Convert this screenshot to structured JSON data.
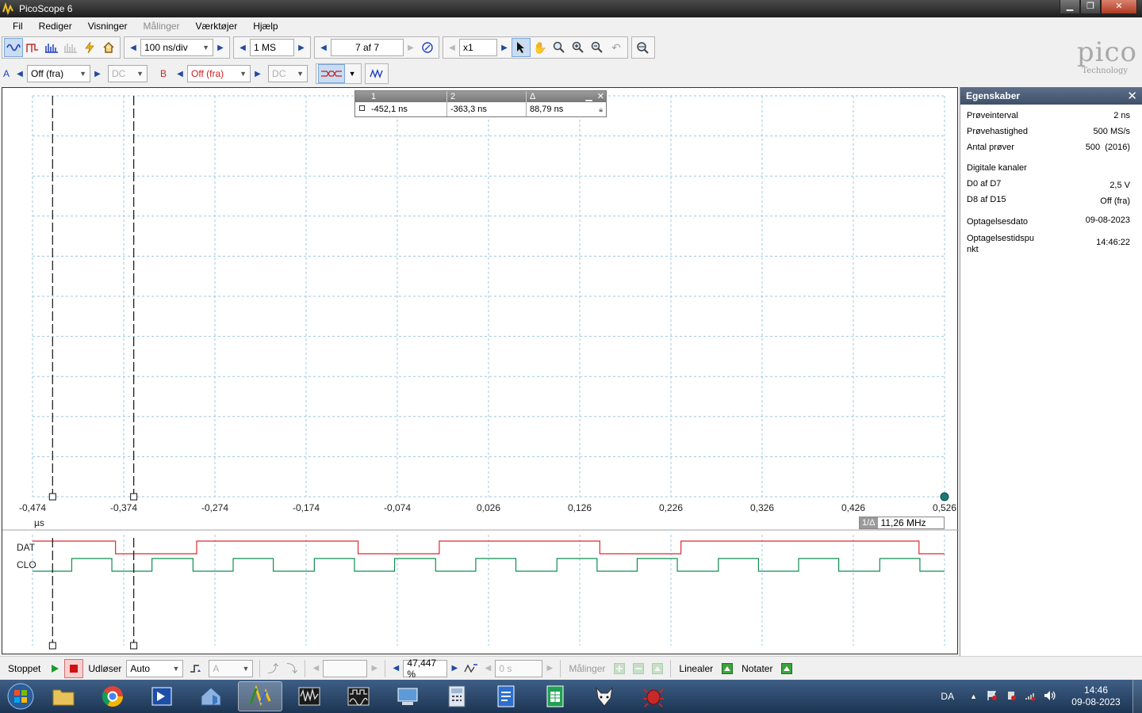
{
  "window": {
    "title": "PicoScope 6"
  },
  "menu": [
    "Fil",
    "Rediger",
    "Visninger",
    "Målinger",
    "Værktøjer",
    "Hjælp"
  ],
  "menu_disabled": [
    false,
    false,
    false,
    true,
    false,
    false
  ],
  "toolbar": {
    "timebase": "100 ns/div",
    "samples": "1 MS",
    "buffer": "7 af 7",
    "zoom": "x1"
  },
  "channels": {
    "a": {
      "label": "A",
      "range": "Off (fra)",
      "coupling": "DC",
      "color": "#1f3fbf"
    },
    "b": {
      "label": "B",
      "range": "Off (fra)",
      "coupling": "DC",
      "color": "#d02020"
    }
  },
  "logo": {
    "text": "pico",
    "sub": "Technology"
  },
  "scope": {
    "x_ticks": [
      "-0,474",
      "-0,374",
      "-0,274",
      "-0,174",
      "-0,074",
      "0,026",
      "0,126",
      "0,226",
      "0,326",
      "0,426",
      "0,526"
    ],
    "x_unit": "µs",
    "digital_channels": [
      "DAT",
      "CLO"
    ],
    "ruler_table": {
      "headers": [
        "1",
        "2",
        "Δ"
      ],
      "values": [
        "-452,1 ns",
        "-363,3 ns",
        "88,79 ns"
      ]
    },
    "freq_readout": {
      "label": "1/Δ",
      "value": "11,26 MHz"
    }
  },
  "chart_data": {
    "type": "line",
    "x_unit": "µs",
    "x_range": [
      -0.474,
      0.526
    ],
    "rulers_x": [
      -0.452,
      -0.363
    ],
    "series": [
      {
        "name": "DAT",
        "color": "#e0282c",
        "steps": [
          [
            -0.474,
            1
          ],
          [
            -0.383,
            0
          ],
          [
            -0.294,
            1
          ],
          [
            -0.117,
            0
          ],
          [
            -0.028,
            1
          ],
          [
            0.148,
            0
          ],
          [
            0.237,
            1
          ],
          [
            0.498,
            0
          ],
          [
            0.526,
            0
          ]
        ]
      },
      {
        "name": "CLO",
        "color": "#0f8f52",
        "steps": [
          [
            -0.474,
            0
          ],
          [
            -0.431,
            1
          ],
          [
            -0.387,
            0
          ],
          [
            -0.343,
            1
          ],
          [
            -0.298,
            0
          ],
          [
            -0.254,
            1
          ],
          [
            -0.21,
            0
          ],
          [
            -0.165,
            1
          ],
          [
            -0.121,
            0
          ],
          [
            -0.077,
            1
          ],
          [
            -0.032,
            0
          ],
          [
            0.012,
            1
          ],
          [
            0.056,
            0
          ],
          [
            0.101,
            1
          ],
          [
            0.145,
            0
          ],
          [
            0.189,
            1
          ],
          [
            0.233,
            0
          ],
          [
            0.278,
            1
          ],
          [
            0.322,
            0
          ],
          [
            0.366,
            1
          ],
          [
            0.41,
            0
          ],
          [
            0.455,
            1
          ],
          [
            0.499,
            0
          ],
          [
            0.526,
            0
          ]
        ]
      }
    ]
  },
  "properties": {
    "title": "Egenskaber",
    "rows": [
      {
        "label": "Prøveinterval",
        "value": "2 ns"
      },
      {
        "label": "Prøvehastighed",
        "value": "500 MS/s"
      },
      {
        "label": "Antal prøver",
        "value": "500  (2016)"
      },
      {
        "label": "Digitale kanaler",
        "value": ""
      },
      {
        "label": "D0 af D7",
        "value": "2,5 V"
      },
      {
        "label": "D8 af D15",
        "value": "Off (fra)"
      },
      {
        "label": "Optagelsesdato",
        "value": "09-08-2023"
      },
      {
        "label": "Optagelsestidspu nkt",
        "value": "14:46:22"
      }
    ]
  },
  "statusbar": {
    "state": "Stoppet",
    "trigger_label": "Udløser",
    "trigger_mode": "Auto",
    "trigger_source": "A",
    "pretrigger": "47,447 %",
    "delay": "0 s",
    "measurements": "Målinger",
    "rulers": "Linealer",
    "notes": "Notater"
  },
  "taskbar": {
    "language": "DA",
    "time": "14:46",
    "date": "09-08-2023"
  }
}
